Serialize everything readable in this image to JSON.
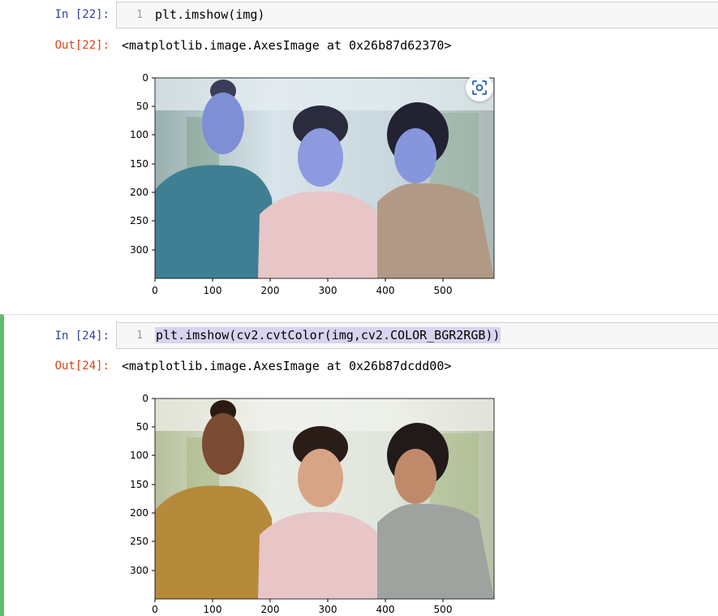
{
  "cells": [
    {
      "in_prompt": "In [22]:",
      "line_number": "1",
      "code": "plt.imshow(img)",
      "out_prompt": "Out[22]:",
      "output_text": "<matplotlib.image.AxesImage at 0x26b87d62370>",
      "x_ticks": [
        "0",
        "100",
        "200",
        "300",
        "400",
        "500"
      ],
      "y_ticks": [
        "0",
        "50",
        "100",
        "150",
        "200",
        "250",
        "300"
      ],
      "image_colors": {
        "skin": "#7f8fd6",
        "shirt_left": "#3f7f93",
        "shirt_mid": "#e8c6c8",
        "jacket_right": "#b09a85"
      }
    },
    {
      "in_prompt": "In [24]:",
      "line_number": "1",
      "code": "plt.imshow(cv2.cvtColor(img,cv2.COLOR_BGR2RGB))",
      "out_prompt": "Out[24]:",
      "output_text": "<matplotlib.image.AxesImage at 0x26b87dcdd00>",
      "x_ticks": [
        "0",
        "100",
        "200",
        "300",
        "400",
        "500"
      ],
      "y_ticks": [
        "0",
        "50",
        "100",
        "150",
        "200",
        "250",
        "300"
      ],
      "image_colors": {
        "skin": "#c08a6a",
        "skin_dark": "#7a4a32",
        "shirt_left": "#b58a3a",
        "shirt_mid": "#e8c6c8",
        "jacket_right": "#9ea3a0"
      }
    }
  ],
  "zoom_icon": "focus-scan-icon"
}
